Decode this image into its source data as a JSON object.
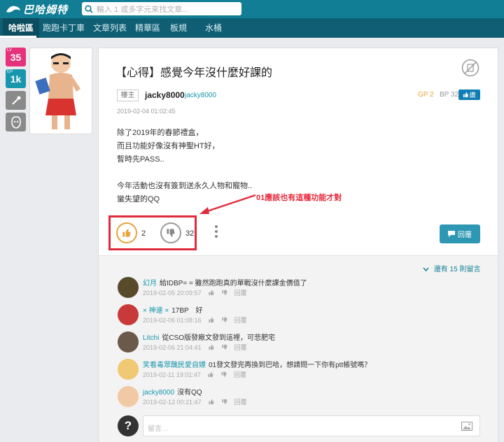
{
  "header": {
    "logo_text": "巴哈姆特",
    "search_placeholder": "輸入 1 或多字元來找文章..."
  },
  "nav": {
    "items": [
      "哈啦區",
      "跑跑卡丁車",
      "文章列表",
      "精華區",
      "板規",
      "水桶"
    ]
  },
  "user_badges": [
    {
      "small": "LV",
      "value": "35",
      "color": "#e6327a"
    },
    {
      "small": "EP",
      "value": "1k",
      "color": "#1796ad"
    }
  ],
  "post": {
    "title": "【心得】感覺今年沒什麼好課的",
    "role_tag": "樓主",
    "author": "jacky8000",
    "author_id": "jacky8000",
    "gp_label": "GP 2",
    "bp_label": "BP 32",
    "bp_button": "讚",
    "date": "2019-02-04 01:02:45",
    "lines": [
      "除了2019年的春節禮盒，",
      "而且功能好像沒有神聖HT好，",
      "暫時先PASS..",
      "",
      "今年活動也沒有簽到送永久人物和寵物..",
      "蠻失望的QQ"
    ],
    "likes": "2",
    "dislikes": "32",
    "reply_label": "回覆"
  },
  "annotation": "01應該也有這種功能才對",
  "comments": {
    "more_label": "還有 15 則留言",
    "reply_label": "回覆",
    "items": [
      {
        "name": "幻月",
        "text": "給IDBP= = 雖然跑跑真的單戰沒什麼課金價值了",
        "date": "2019-02-05 20:09:57"
      },
      {
        "name": "× 神速 ×",
        "text": "17BP　好",
        "date": "2019-02-06 01:08:16"
      },
      {
        "name": "Litchi",
        "text": "從CSO版發廠文發到這裡，可悲肥宅",
        "date": "2019-02-06 21:04:41"
      },
      {
        "name": "笑看毒眾醜民愛自嫖",
        "text": "01發文發完再換到巴哈，想請問一下你有ptt帳號嗎？",
        "date": "2019-02-11 19:01:47"
      },
      {
        "name": "jacky8000",
        "text": "沒有QQ",
        "date": "2019-02-12 00:21:47"
      }
    ],
    "input_placeholder": "留言…"
  }
}
